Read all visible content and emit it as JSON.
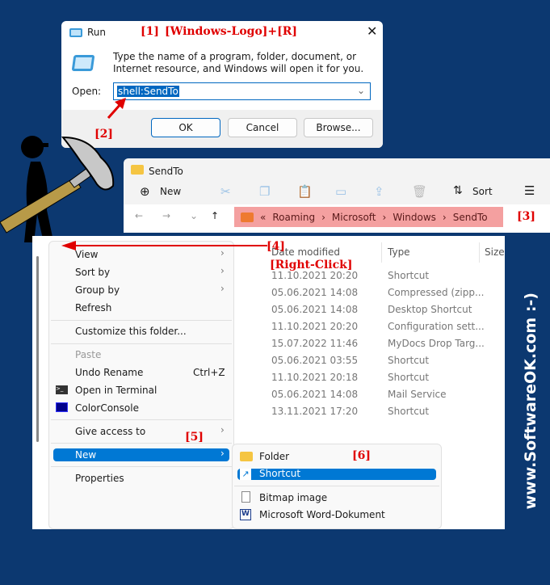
{
  "annotations": {
    "a1": "[1]",
    "a1b": "[Windows-Logo]+[R]",
    "a2": "[2]",
    "a3": "[3]",
    "a4": "[4]",
    "a4b": "[Right-Click]",
    "a5": "[5]",
    "a6": "[6]"
  },
  "side_text": "www.SoftwareOK.com :-)",
  "run": {
    "title": "Run",
    "description": "Type the name of a program, folder, document, or Internet resource, and Windows will open it for you.",
    "open_label": "Open:",
    "open_value": "shell:SendTo",
    "ok": "OK",
    "cancel": "Cancel",
    "browse": "Browse..."
  },
  "explorer": {
    "title": "SendTo",
    "new": "New",
    "sort": "Sort",
    "breadcrumb": [
      "Roaming",
      "Microsoft",
      "Windows",
      "SendTo"
    ],
    "columns": [
      "Date modified",
      "Type",
      "Size"
    ],
    "rows": [
      [
        "11.10.2021 20:20",
        "Shortcut"
      ],
      [
        "05.06.2021 14:08",
        "Compressed (zipp..."
      ],
      [
        "05.06.2021 14:08",
        "Desktop Shortcut"
      ],
      [
        "11.10.2021 20:20",
        "Configuration sett..."
      ],
      [
        "15.07.2022 11:46",
        "MyDocs Drop Targ..."
      ],
      [
        "05.06.2021 03:55",
        "Shortcut"
      ],
      [
        "11.10.2021 20:18",
        "Shortcut"
      ],
      [
        "05.06.2021 14:08",
        "Mail Service"
      ],
      [
        "13.11.2021 17:20",
        "Shortcut"
      ]
    ]
  },
  "context_menu": {
    "view": "View",
    "sort_by": "Sort by",
    "group_by": "Group by",
    "refresh": "Refresh",
    "customize": "Customize this folder...",
    "paste": "Paste",
    "undo": "Undo Rename",
    "undo_shortcut": "Ctrl+Z",
    "terminal": "Open in Terminal",
    "colorconsole": "ColorConsole",
    "give_access": "Give access to",
    "new": "New",
    "properties": "Properties"
  },
  "submenu": {
    "folder": "Folder",
    "shortcut": "Shortcut",
    "bitmap": "Bitmap image",
    "word": "Microsoft Word-Dokument"
  },
  "colors": {
    "background": "#0c3870",
    "accent": "#0078d4",
    "annotation": "#e00000"
  }
}
